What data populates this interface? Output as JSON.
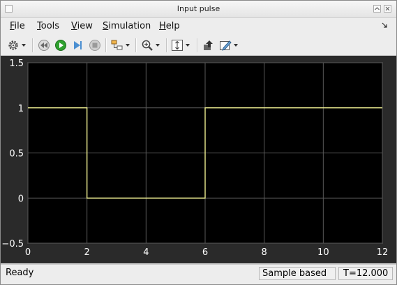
{
  "window": {
    "title": "Input pulse"
  },
  "menu": [
    {
      "label": "File",
      "key": "F",
      "rest": "ile"
    },
    {
      "label": "Tools",
      "key": "T",
      "rest": "ools"
    },
    {
      "label": "View",
      "key": "V",
      "rest": "iew"
    },
    {
      "label": "Simulation",
      "key": "S",
      "rest": "imulation"
    },
    {
      "label": "Help",
      "key": "H",
      "rest": "elp"
    }
  ],
  "toolbar": {
    "icons": [
      "settings-icon",
      "step-back-icon",
      "run-icon",
      "step-forward-icon",
      "stop-icon",
      "highlight-block-icon",
      "zoom-icon",
      "scale-axes-icon",
      "bring-to-front-icon",
      "style-icon"
    ]
  },
  "status": {
    "text": "Ready",
    "mode": "Sample based",
    "time": "T=12.000"
  },
  "colors": {
    "plot_bg": "#000000",
    "figure_bg": "#2a2a2a",
    "grid": "#5a5a5a",
    "line": "#ffff99",
    "tick_text": "#ffffff"
  },
  "chart_data": {
    "type": "line",
    "title": "",
    "xlabel": "",
    "ylabel": "",
    "xlim": [
      0,
      12
    ],
    "ylim": [
      -0.5,
      1.5
    ],
    "xticks": [
      0,
      2,
      4,
      6,
      8,
      10,
      12
    ],
    "yticks": [
      -0.5,
      0,
      0.5,
      1,
      1.5
    ],
    "grid": true,
    "series": [
      {
        "x": [
          0,
          2,
          2,
          6,
          6,
          12
        ],
        "y": [
          1,
          1,
          0,
          0,
          1,
          1
        ]
      }
    ]
  }
}
